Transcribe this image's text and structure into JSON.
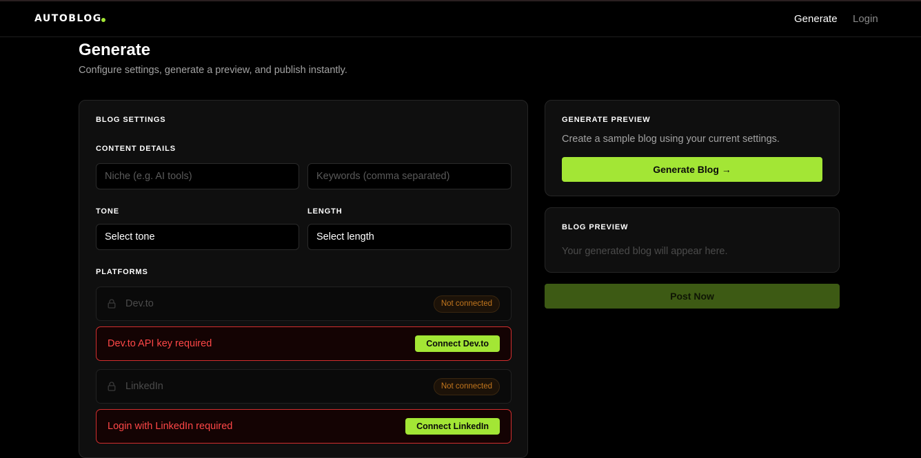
{
  "nav": {
    "brand": "AUTOBLOG",
    "links": {
      "generate": "Generate",
      "login": "Login"
    }
  },
  "page": {
    "title": "Generate",
    "subtitle": "Configure settings, generate a preview, and publish instantly."
  },
  "settings": {
    "heading": "BLOG SETTINGS",
    "content_details": {
      "label": "CONTENT DETAILS",
      "niche_placeholder": "Niche (e.g. AI tools)",
      "niche_value": "",
      "keywords_placeholder": "Keywords (comma separated)",
      "keywords_value": ""
    },
    "tone": {
      "label": "TONE",
      "value": "Select tone"
    },
    "length": {
      "label": "LENGTH",
      "value": "Select length"
    },
    "platforms": {
      "label": "PLATFORMS",
      "items": [
        {
          "name": "Dev.to",
          "status": "Not connected",
          "alert": "Dev.to API key required",
          "button": "Connect Dev.to"
        },
        {
          "name": "LinkedIn",
          "status": "Not connected",
          "alert": "Login with LinkedIn required",
          "button": "Connect LinkedIn"
        }
      ]
    }
  },
  "generate_preview": {
    "heading": "GENERATE PREVIEW",
    "description": "Create a sample blog using your current settings.",
    "button": "Generate Blog →"
  },
  "blog_preview": {
    "heading": "BLOG PREVIEW",
    "placeholder": "Your generated blog will appear here."
  },
  "post_button": "Post Now",
  "colors": {
    "accent": "#a3e635",
    "accent_disabled": "#3d5a14",
    "error": "#ff4747",
    "warning": "#c2761d",
    "background": "#000000",
    "card": "#0f0f0f"
  },
  "icons": {
    "platform_lock": "lock-icon",
    "brand_dot": "status-dot"
  }
}
